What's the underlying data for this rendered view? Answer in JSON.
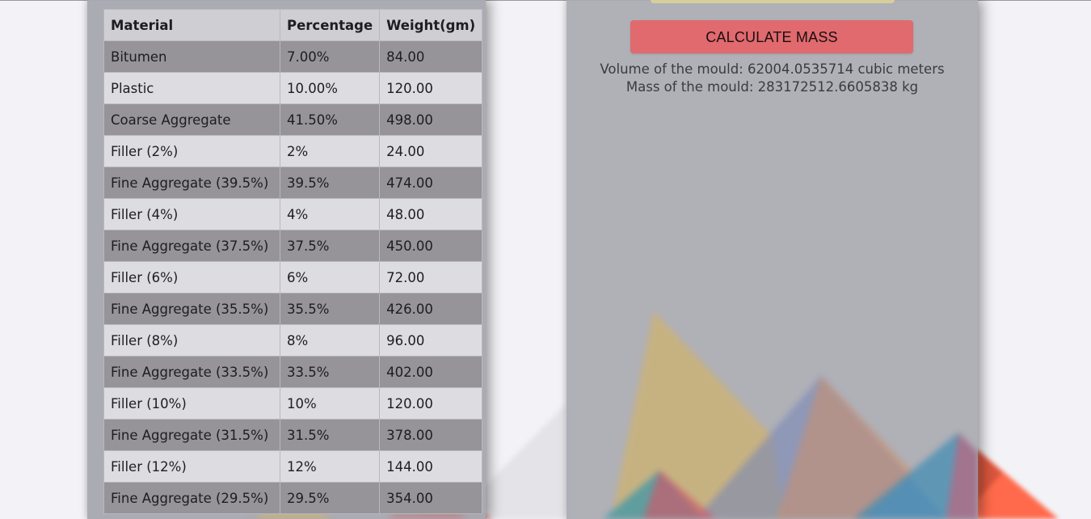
{
  "table": {
    "headers": [
      "Material",
      "Percentage",
      "Weight(gm)"
    ],
    "rows": [
      {
        "material": "Bitumen",
        "percentage": "7.00%",
        "weight": "84.00"
      },
      {
        "material": "Plastic",
        "percentage": "10.00%",
        "weight": "120.00"
      },
      {
        "material": "Coarse Aggregate",
        "percentage": "41.50%",
        "weight": "498.00"
      },
      {
        "material": "Filler (2%)",
        "percentage": "2%",
        "weight": "24.00"
      },
      {
        "material": "Fine Aggregate (39.5%)",
        "percentage": "39.5%",
        "weight": "474.00"
      },
      {
        "material": "Filler (4%)",
        "percentage": "4%",
        "weight": "48.00"
      },
      {
        "material": "Fine Aggregate (37.5%)",
        "percentage": "37.5%",
        "weight": "450.00"
      },
      {
        "material": "Filler (6%)",
        "percentage": "6%",
        "weight": "72.00"
      },
      {
        "material": "Fine Aggregate (35.5%)",
        "percentage": "35.5%",
        "weight": "426.00"
      },
      {
        "material": "Filler (8%)",
        "percentage": "8%",
        "weight": "96.00"
      },
      {
        "material": "Fine Aggregate (33.5%)",
        "percentage": "33.5%",
        "weight": "402.00"
      },
      {
        "material": "Filler (10%)",
        "percentage": "10%",
        "weight": "120.00"
      },
      {
        "material": "Fine Aggregate (31.5%)",
        "percentage": "31.5%",
        "weight": "378.00"
      },
      {
        "material": "Filler (12%)",
        "percentage": "12%",
        "weight": "144.00"
      },
      {
        "material": "Fine Aggregate (29.5%)",
        "percentage": "29.5%",
        "weight": "354.00"
      }
    ]
  },
  "calculator": {
    "button_label": "CALCULATE MASS",
    "volume_text": "Volume of the mould: 62004.0535714 cubic meters",
    "mass_text": "Mass of the mould: 283172512.6605838 kg"
  },
  "colors": {
    "button": "#e06a6e",
    "row_dark": "#969399",
    "row_light": "#dddce1",
    "page_background": "#f3f3f7",
    "accent_orange": "#ff6a4c"
  }
}
